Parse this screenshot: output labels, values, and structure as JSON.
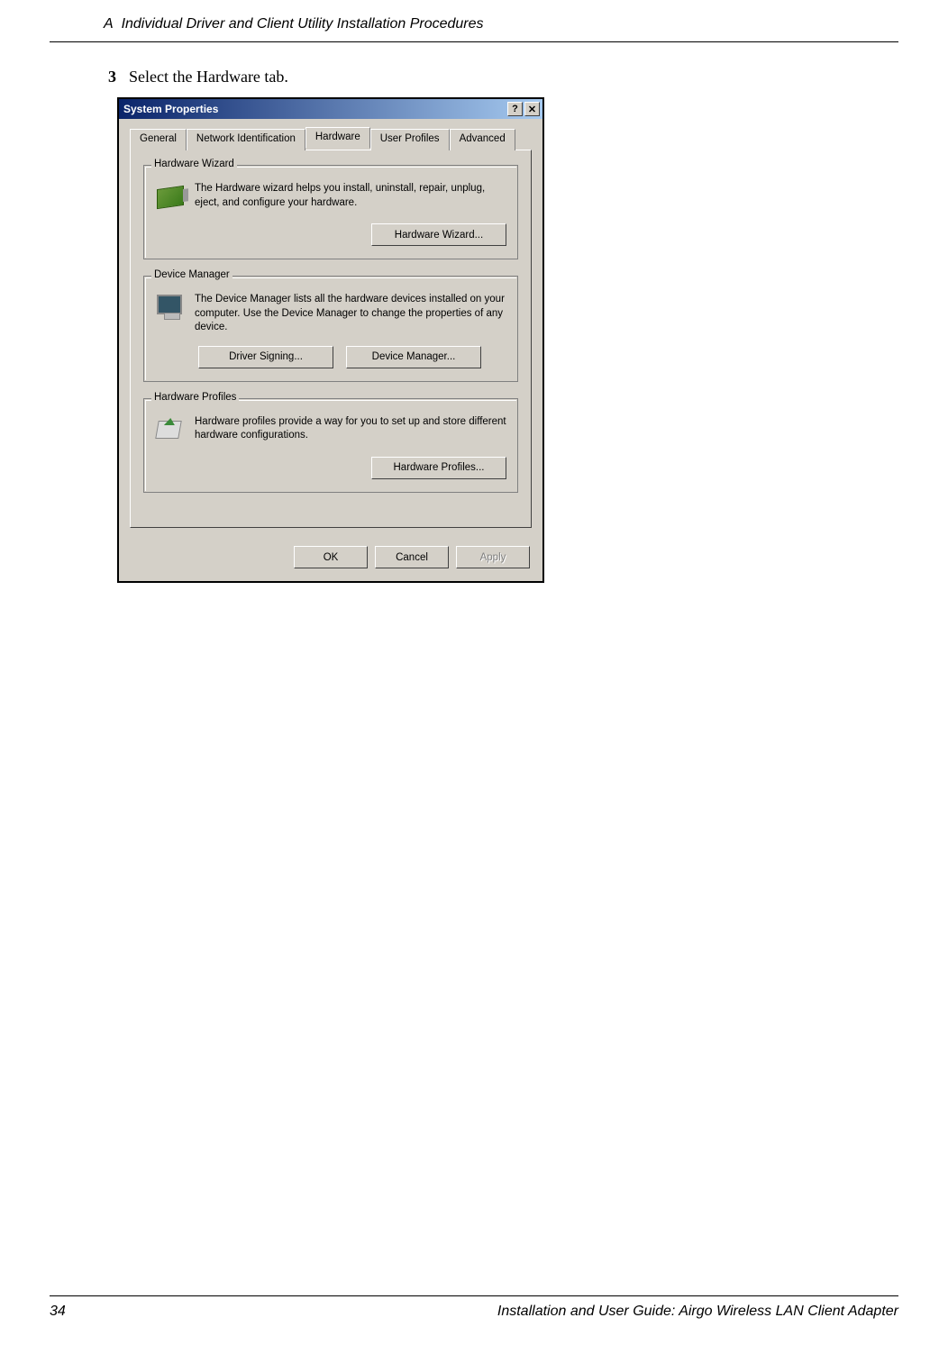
{
  "header": {
    "chapter_label": "A",
    "chapter_title": "Individual Driver and Client Utility Installation Procedures"
  },
  "step": {
    "number": "3",
    "text": "Select the Hardware tab."
  },
  "dialog": {
    "title": "System Properties",
    "help_glyph": "?",
    "close_glyph": "✕",
    "tabs": {
      "general": "General",
      "network_id": "Network Identification",
      "hardware": "Hardware",
      "user_profiles": "User Profiles",
      "advanced": "Advanced"
    },
    "groups": {
      "wizard": {
        "legend": "Hardware Wizard",
        "text": "The Hardware wizard helps you install, uninstall, repair, unplug, eject, and configure your hardware.",
        "button": "Hardware Wizard..."
      },
      "device_manager": {
        "legend": "Device Manager",
        "text": "The Device Manager lists all the hardware devices installed on your computer. Use the Device Manager to change the properties of any device.",
        "button_signing": "Driver Signing...",
        "button_manager": "Device Manager..."
      },
      "profiles": {
        "legend": "Hardware Profiles",
        "text": "Hardware profiles provide a way for you to set up and store different hardware configurations.",
        "button": "Hardware Profiles..."
      }
    },
    "footer": {
      "ok": "OK",
      "cancel": "Cancel",
      "apply": "Apply"
    }
  },
  "footer": {
    "page_number": "34",
    "guide_title": "Installation and User Guide: Airgo Wireless LAN Client Adapter"
  }
}
